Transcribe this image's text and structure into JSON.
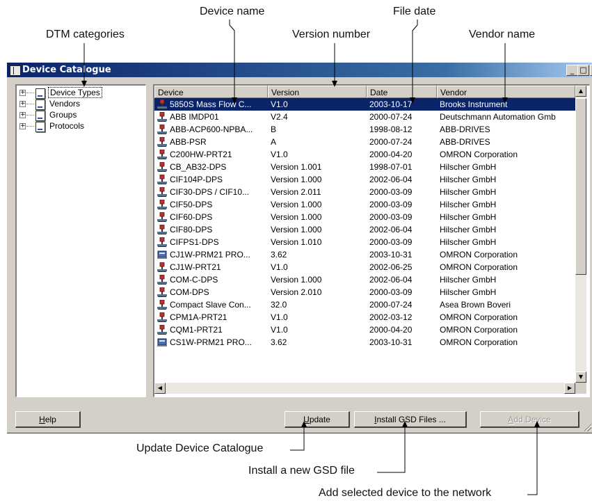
{
  "callouts": {
    "dtm_categories": "DTM categories",
    "device_name": "Device name",
    "version_number": "Version number",
    "file_date": "File date",
    "vendor_name": "Vendor name",
    "update_catalogue": "Update Device Catalogue",
    "install_gsd": "Install a new GSD file",
    "add_device": "Add selected device to the network"
  },
  "window": {
    "title": "Device Catalogue",
    "controls": {
      "minimize": "_",
      "maximize": "□",
      "close": "×"
    }
  },
  "tree": {
    "items": [
      {
        "label": "Device Types",
        "expander": "+",
        "selected": true
      },
      {
        "label": "Vendors",
        "expander": "+"
      },
      {
        "label": "Groups",
        "expander": "+"
      },
      {
        "label": "Protocols",
        "expander": "+"
      }
    ]
  },
  "table": {
    "columns": [
      "Device",
      "Version",
      "Date",
      "Vendor"
    ],
    "rows": [
      {
        "device": "5850S Mass Flow C...",
        "version": "V1.0",
        "date": "2003-10-17",
        "vendor": "Brooks Instrument",
        "icon": "device-icon",
        "selected": true
      },
      {
        "device": "ABB IMDP01",
        "version": "V2.4",
        "date": "2000-07-24",
        "vendor": "Deutschmann Automation Gmb",
        "icon": "device-icon"
      },
      {
        "device": "ABB-ACP600-NPBA...",
        "version": "B",
        "date": "1998-08-12",
        "vendor": "ABB-DRIVES",
        "icon": "device-icon"
      },
      {
        "device": "ABB-PSR",
        "version": "A",
        "date": "2000-07-24",
        "vendor": "ABB-DRIVES",
        "icon": "device-icon"
      },
      {
        "device": "C200HW-PRT21",
        "version": "V1.0",
        "date": "2000-04-20",
        "vendor": "OMRON Corporation",
        "icon": "device-icon"
      },
      {
        "device": "CB_AB32-DPS",
        "version": "Version 1.001",
        "date": "1998-07-01",
        "vendor": "Hilscher GmbH",
        "icon": "device-icon"
      },
      {
        "device": "CIF104P-DPS",
        "version": "Version 1.000",
        "date": "2002-06-04",
        "vendor": "Hilscher GmbH",
        "icon": "device-icon"
      },
      {
        "device": "CIF30-DPS / CIF10...",
        "version": "Version 2.011",
        "date": "2000-03-09",
        "vendor": "Hilscher GmbH",
        "icon": "device-icon"
      },
      {
        "device": "CIF50-DPS",
        "version": "Version 1.000",
        "date": "2000-03-09",
        "vendor": "Hilscher GmbH",
        "icon": "device-icon"
      },
      {
        "device": "CIF60-DPS",
        "version": "Version 1.000",
        "date": "2000-03-09",
        "vendor": "Hilscher GmbH",
        "icon": "device-icon"
      },
      {
        "device": "CIF80-DPS",
        "version": "Version 1.000",
        "date": "2002-06-04",
        "vendor": "Hilscher GmbH",
        "icon": "device-icon"
      },
      {
        "device": "CIFPS1-DPS",
        "version": "Version 1.010",
        "date": "2000-03-09",
        "vendor": "Hilscher GmbH",
        "icon": "device-icon"
      },
      {
        "device": "CJ1W-PRM21 PRO...",
        "version": "3.62",
        "date": "2003-10-31",
        "vendor": "OMRON Corporation",
        "icon": "plc-module-icon"
      },
      {
        "device": "CJ1W-PRT21",
        "version": "V1.0",
        "date": "2002-06-25",
        "vendor": "OMRON Corporation",
        "icon": "device-icon"
      },
      {
        "device": "COM-C-DPS",
        "version": "Version 1.000",
        "date": "2002-06-04",
        "vendor": "Hilscher GmbH",
        "icon": "device-icon"
      },
      {
        "device": "COM-DPS",
        "version": "Version 2.010",
        "date": "2000-03-09",
        "vendor": "Hilscher GmbH",
        "icon": "device-icon"
      },
      {
        "device": "Compact Slave Con...",
        "version": "32.0",
        "date": "2000-07-24",
        "vendor": "Asea Brown Boveri",
        "icon": "device-icon"
      },
      {
        "device": "CPM1A-PRT21",
        "version": "V1.0",
        "date": "2002-03-12",
        "vendor": "OMRON Corporation",
        "icon": "device-icon"
      },
      {
        "device": "CQM1-PRT21",
        "version": "V1.0",
        "date": "2000-04-20",
        "vendor": "OMRON Corporation",
        "icon": "device-icon"
      },
      {
        "device": "CS1W-PRM21 PRO...",
        "version": "3.62",
        "date": "2003-10-31",
        "vendor": "OMRON Corporation",
        "icon": "plc-module-icon"
      }
    ]
  },
  "scrollbars": {
    "up": "▲",
    "down": "▼",
    "left": "◀",
    "right": "▶"
  },
  "buttons": {
    "help": {
      "mnemonic": "H",
      "rest": "elp"
    },
    "update": {
      "mnemonic": "U",
      "rest": "pdate"
    },
    "install": {
      "mnemonic": "I",
      "rest": "nstall GSD Files ..."
    },
    "add_device": {
      "mnemonic": "A",
      "rest": "dd Device",
      "enabled": false
    }
  },
  "colors": {
    "selection": "#0a246a",
    "title_gradient_start": "#0a246a",
    "title_gradient_end": "#a6caf0",
    "face": "#d4d0c8"
  }
}
